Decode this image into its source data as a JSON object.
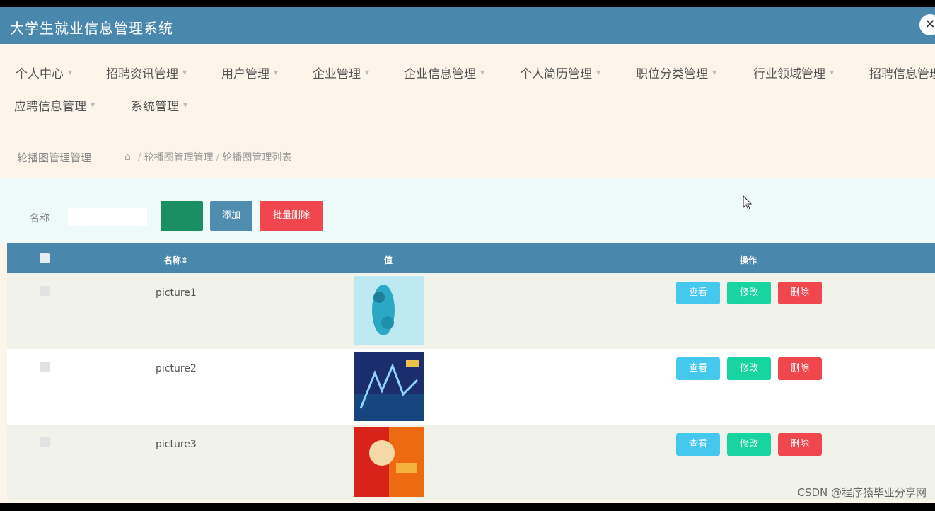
{
  "app": {
    "title": "大学生就业信息管理系统",
    "close_glyph": "✕"
  },
  "nav": {
    "row1": [
      "个人中心",
      "招聘资讯管理",
      "用户管理",
      "企业管理",
      "企业信息管理",
      "个人简历管理",
      "职位分类管理",
      "行业领域管理",
      "招聘信息管理"
    ],
    "row2": [
      "应聘信息管理",
      "系统管理"
    ]
  },
  "breadcrumb": {
    "title": "轮播图管理管理",
    "path": [
      "轮播图管理管理",
      "轮播图管理列表"
    ]
  },
  "search": {
    "label": "名称",
    "placeholder": "",
    "search_label": "",
    "add_label": "添加",
    "batch_delete_label": "批量删除"
  },
  "table": {
    "headers": {
      "name": "名称",
      "value": "值",
      "actions": "操作"
    },
    "rows": [
      {
        "name": "picture1"
      },
      {
        "name": "picture2"
      },
      {
        "name": "picture3"
      }
    ],
    "actions": {
      "view": "查看",
      "edit": "修改",
      "delete": "删除"
    }
  },
  "watermark": "CSDN @程序猿毕业分享网",
  "colors": {
    "header": "#4a87ad",
    "page_bg": "#fdf4ea",
    "view_btn": "#45c8ee",
    "edit_btn": "#17d4a0",
    "delete_btn": "#f0474f",
    "search_btn": "#1a8f64"
  }
}
